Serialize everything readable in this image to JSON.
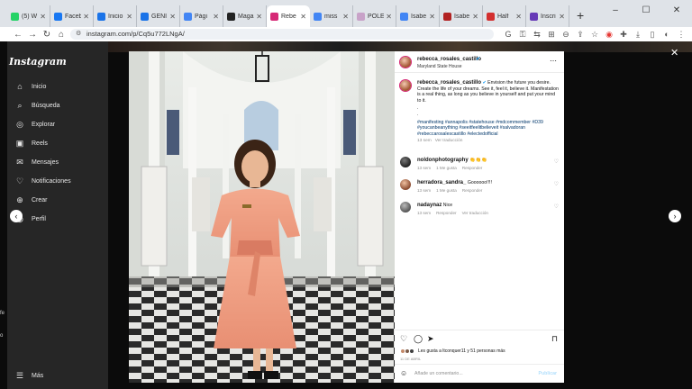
{
  "browser": {
    "tabs": [
      {
        "label": "(5) W",
        "color": "#25d366"
      },
      {
        "label": "Faceb",
        "color": "#1877f2"
      },
      {
        "label": "Inicio",
        "color": "#1a73e8"
      },
      {
        "label": "GENI",
        "color": "#1a73e8"
      },
      {
        "label": "Pági",
        "color": "#4285f4"
      },
      {
        "label": "Maga",
        "color": "#222222"
      },
      {
        "label": "Rebe",
        "color": "#d62976"
      },
      {
        "label": "miss",
        "color": "#4285f4"
      },
      {
        "label": "POLE",
        "color": "#c8a2c8"
      },
      {
        "label": "Isabe",
        "color": "#4285f4"
      },
      {
        "label": "Isabe",
        "color": "#b22222"
      },
      {
        "label": "Half",
        "color": "#d32f2f"
      },
      {
        "label": "Inscri",
        "color": "#673ab7"
      }
    ],
    "url": "instagram.com/p/Cq5u772LNgA/"
  },
  "sidebar": {
    "logo": "Instagram",
    "items": [
      {
        "label": "Inicio",
        "icon": "home-icon"
      },
      {
        "label": "Búsqueda",
        "icon": "search-icon"
      },
      {
        "label": "Explorar",
        "icon": "compass-icon"
      },
      {
        "label": "Reels",
        "icon": "reels-icon"
      },
      {
        "label": "Mensajes",
        "icon": "messenger-icon"
      },
      {
        "label": "Notificaciones",
        "icon": "heart-icon"
      },
      {
        "label": "Crear",
        "icon": "plus-icon"
      },
      {
        "label": "Perfil",
        "icon": "profile-icon"
      }
    ],
    "more": "Más",
    "left_texts": [
      "fe",
      "o"
    ]
  },
  "post": {
    "author": "rebecca_rosales_castillo",
    "location": "Maryland State House",
    "caption": "Envision the future you desire. Create the life of your dreams. See it, feel it, believe it. Manifestation is a real thing, as long as you believe in yourself and put your mind to it.",
    "dots": ".",
    "hashtags": "#manifesting #annapolis #statehouse #mdcommember #D39 #youcanbeanything #seeitfeelitbelieveit #salvadoran #rebeccarosalescastillo #electedofficial",
    "caption_time": "13 sem",
    "caption_translate": "Ver traducción",
    "comments": [
      {
        "user": "noldonphotography",
        "text": "👏👏👏",
        "time": "13 sem",
        "likes": "1 Me gusta",
        "reply": "Responder",
        "translate": ""
      },
      {
        "user": "herradora_sandra_",
        "text": "Goooooo!!!!",
        "time": "13 sem",
        "likes": "1 Me gusta",
        "reply": "Responder",
        "translate": ""
      },
      {
        "user": "nadaynaz",
        "text": "Nice",
        "time": "13 sem",
        "likes": "",
        "reply": "Responder",
        "translate": "Ver traducción"
      }
    ],
    "likes_text": "Les gusta a ltconquer11 y 51 personas más",
    "posted_ago": "11 DE ABRIL",
    "comment_placeholder": "Añade un comentario...",
    "publish_label": "Publicar"
  }
}
